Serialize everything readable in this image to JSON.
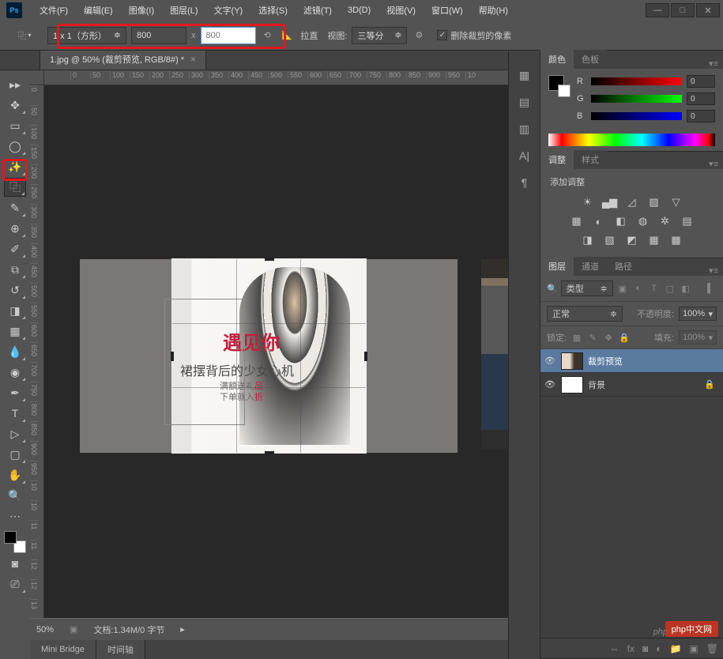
{
  "menu": {
    "items": [
      "文件(F)",
      "编辑(E)",
      "图像(I)",
      "图层(L)",
      "文字(Y)",
      "选择(S)",
      "滤镜(T)",
      "3D(D)",
      "视图(V)",
      "窗口(W)",
      "帮助(H)"
    ]
  },
  "options": {
    "ratio_label": "1 x 1（方形）",
    "width": "800",
    "x": "x",
    "height": "800",
    "straighten": "拉直",
    "view_label": "视图:",
    "view_value": "三等分",
    "delete_cropped": "删除裁剪的像素"
  },
  "document": {
    "tab_title": "1.jpg @ 50% (裁剪预览, RGB/8#) *"
  },
  "canvas": {
    "image_text": {
      "title": "遇见你",
      "subtitle": "裙摆背后的少女心机",
      "line2a": "满额送礼",
      "line2b": "品",
      "line3a": "下单就入",
      "line3b": "折"
    },
    "h_ticks": [
      "0",
      "50",
      "100",
      "150",
      "200",
      "250",
      "300",
      "350",
      "400",
      "450",
      "500",
      "550",
      "600",
      "650",
      "700",
      "750",
      "800",
      "850",
      "900",
      "950",
      "10"
    ],
    "v_ticks": [
      "0",
      "50",
      "100",
      "150",
      "200",
      "250",
      "300",
      "350",
      "400",
      "450",
      "500",
      "550",
      "600",
      "650",
      "700",
      "750",
      "800",
      "850",
      "900",
      "950",
      "10",
      "10",
      "11",
      "11",
      "12",
      "12",
      "13"
    ]
  },
  "status": {
    "zoom": "50%",
    "doc_info": "文档:1.34M/0 字节"
  },
  "bottom_tabs": [
    "Mini Bridge",
    "时间轴"
  ],
  "panels": {
    "color": {
      "tabs": [
        "颜色",
        "色板"
      ],
      "r_label": "R",
      "r_val": "0",
      "g_label": "G",
      "g_val": "0",
      "b_label": "B",
      "b_val": "0"
    },
    "adjust": {
      "tabs": [
        "调整",
        "样式"
      ],
      "text": "添加调整"
    },
    "layers": {
      "tabs": [
        "图层",
        "通道",
        "路径"
      ],
      "type_label": "类型",
      "blend_mode": "正常",
      "opacity_label": "不透明度:",
      "opacity_val": "100%",
      "lock_label": "锁定:",
      "fill_label": "填充:",
      "fill_val": "100%",
      "items": [
        {
          "name": "裁剪预览",
          "selected": true
        },
        {
          "name": "背景",
          "selected": false
        }
      ]
    }
  },
  "watermark_pre": "php",
  "watermark": "php中文网"
}
